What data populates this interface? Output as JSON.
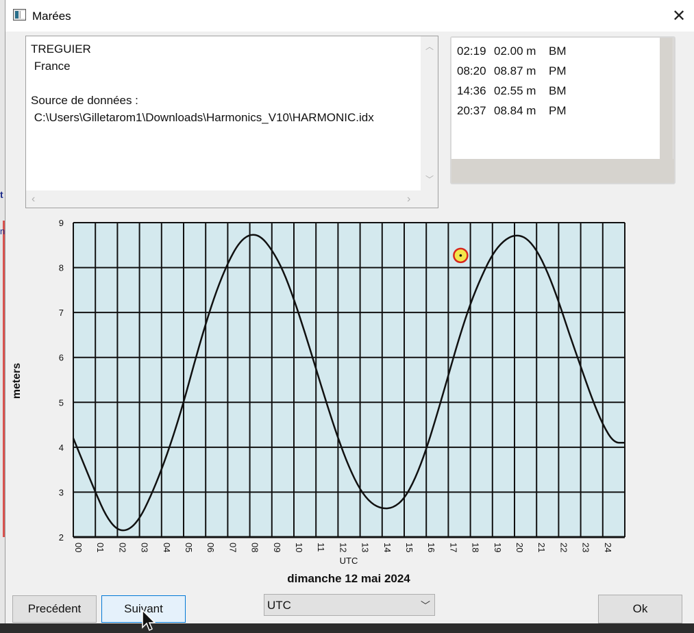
{
  "window": {
    "title": "Marées"
  },
  "info": {
    "lines": [
      "TREGUIER",
      " France",
      "",
      "Source de données :",
      " C:\\Users\\Gilletarom1\\Downloads\\Harmonics_V10\\HARMONIC.idx"
    ]
  },
  "tides": [
    {
      "time": "02:19",
      "height": "02.00 m",
      "type": "BM"
    },
    {
      "time": "08:20",
      "height": "08.87 m",
      "type": "PM"
    },
    {
      "time": "14:36",
      "height": "02.55 m",
      "type": "BM"
    },
    {
      "time": "20:37",
      "height": "08.84 m",
      "type": "PM"
    }
  ],
  "chart_data": {
    "type": "line",
    "ylabel": "meters",
    "xlabel": "UTC",
    "date_label": "dimanche 12 mai 2024",
    "ylim": [
      2,
      9
    ],
    "xlim": [
      0,
      25
    ],
    "x_ticks": [
      "00",
      "01",
      "02",
      "03",
      "04",
      "05",
      "06",
      "07",
      "08",
      "09",
      "10",
      "11",
      "12",
      "13",
      "14",
      "15",
      "16",
      "17",
      "18",
      "19",
      "20",
      "21",
      "22",
      "23",
      "24"
    ],
    "y_ticks": [
      2,
      3,
      4,
      5,
      6,
      7,
      8,
      9
    ],
    "grid": true,
    "background": "#d4e9ee",
    "series": [
      {
        "x": [
          0,
          0.5,
          1,
          1.5,
          2,
          2.5,
          3,
          3.5,
          4,
          4.5,
          5,
          5.5,
          6,
          6.5,
          7,
          7.5,
          8,
          8.5,
          9,
          9.5,
          10,
          10.5,
          11,
          11.5,
          12,
          12.5,
          13,
          13.5,
          14,
          14.5,
          15,
          15.5,
          16,
          16.5,
          17,
          17.5,
          18,
          18.5,
          19,
          19.5,
          20,
          20.5,
          21,
          21.5,
          22,
          22.5,
          23,
          23.5,
          24,
          24.5,
          25
        ],
        "y": [
          4.2,
          3.6,
          3.0,
          2.45,
          2.15,
          2.15,
          2.4,
          2.9,
          3.5,
          4.2,
          5.0,
          5.9,
          6.75,
          7.5,
          8.1,
          8.55,
          8.75,
          8.7,
          8.4,
          7.95,
          7.3,
          6.55,
          5.75,
          4.95,
          4.2,
          3.55,
          3.05,
          2.75,
          2.63,
          2.65,
          2.85,
          3.3,
          3.95,
          4.75,
          5.6,
          6.45,
          7.2,
          7.8,
          8.3,
          8.6,
          8.73,
          8.68,
          8.4,
          7.9,
          7.25,
          6.5,
          5.8,
          5.1,
          4.5,
          4.1,
          4.1
        ]
      }
    ],
    "current_marker": {
      "x": 17.0,
      "y": 8.27
    }
  },
  "controls": {
    "prev_label": "Precédent",
    "next_label": "Suivant",
    "timezone_value": "UTC",
    "ok_label": "Ok"
  }
}
